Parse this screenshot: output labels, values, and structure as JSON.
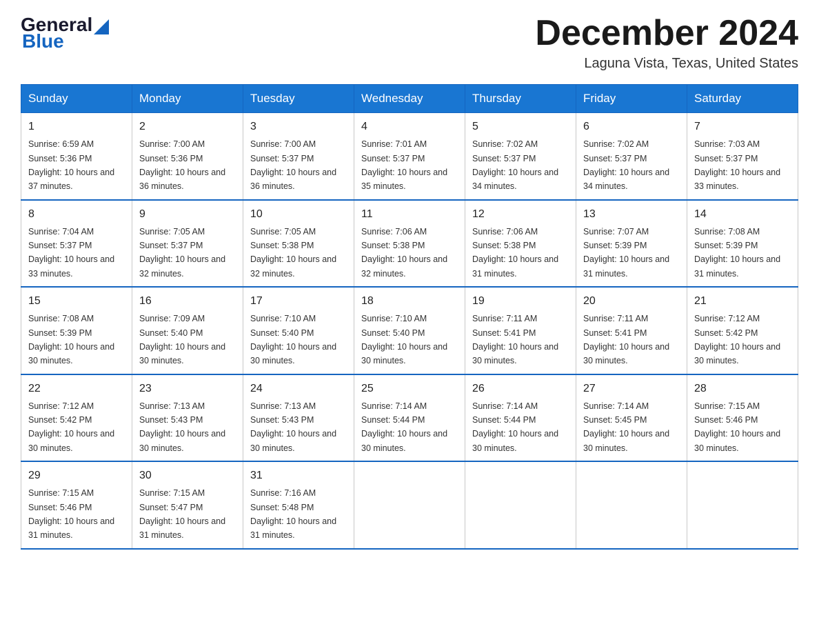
{
  "header": {
    "logo_general": "General",
    "logo_blue": "Blue",
    "month_title": "December 2024",
    "location": "Laguna Vista, Texas, United States"
  },
  "days_of_week": [
    "Sunday",
    "Monday",
    "Tuesday",
    "Wednesday",
    "Thursday",
    "Friday",
    "Saturday"
  ],
  "weeks": [
    [
      {
        "day": "1",
        "sunrise": "6:59 AM",
        "sunset": "5:36 PM",
        "daylight": "10 hours and 37 minutes."
      },
      {
        "day": "2",
        "sunrise": "7:00 AM",
        "sunset": "5:36 PM",
        "daylight": "10 hours and 36 minutes."
      },
      {
        "day": "3",
        "sunrise": "7:00 AM",
        "sunset": "5:37 PM",
        "daylight": "10 hours and 36 minutes."
      },
      {
        "day": "4",
        "sunrise": "7:01 AM",
        "sunset": "5:37 PM",
        "daylight": "10 hours and 35 minutes."
      },
      {
        "day": "5",
        "sunrise": "7:02 AM",
        "sunset": "5:37 PM",
        "daylight": "10 hours and 34 minutes."
      },
      {
        "day": "6",
        "sunrise": "7:02 AM",
        "sunset": "5:37 PM",
        "daylight": "10 hours and 34 minutes."
      },
      {
        "day": "7",
        "sunrise": "7:03 AM",
        "sunset": "5:37 PM",
        "daylight": "10 hours and 33 minutes."
      }
    ],
    [
      {
        "day": "8",
        "sunrise": "7:04 AM",
        "sunset": "5:37 PM",
        "daylight": "10 hours and 33 minutes."
      },
      {
        "day": "9",
        "sunrise": "7:05 AM",
        "sunset": "5:37 PM",
        "daylight": "10 hours and 32 minutes."
      },
      {
        "day": "10",
        "sunrise": "7:05 AM",
        "sunset": "5:38 PM",
        "daylight": "10 hours and 32 minutes."
      },
      {
        "day": "11",
        "sunrise": "7:06 AM",
        "sunset": "5:38 PM",
        "daylight": "10 hours and 32 minutes."
      },
      {
        "day": "12",
        "sunrise": "7:06 AM",
        "sunset": "5:38 PM",
        "daylight": "10 hours and 31 minutes."
      },
      {
        "day": "13",
        "sunrise": "7:07 AM",
        "sunset": "5:39 PM",
        "daylight": "10 hours and 31 minutes."
      },
      {
        "day": "14",
        "sunrise": "7:08 AM",
        "sunset": "5:39 PM",
        "daylight": "10 hours and 31 minutes."
      }
    ],
    [
      {
        "day": "15",
        "sunrise": "7:08 AM",
        "sunset": "5:39 PM",
        "daylight": "10 hours and 30 minutes."
      },
      {
        "day": "16",
        "sunrise": "7:09 AM",
        "sunset": "5:40 PM",
        "daylight": "10 hours and 30 minutes."
      },
      {
        "day": "17",
        "sunrise": "7:10 AM",
        "sunset": "5:40 PM",
        "daylight": "10 hours and 30 minutes."
      },
      {
        "day": "18",
        "sunrise": "7:10 AM",
        "sunset": "5:40 PM",
        "daylight": "10 hours and 30 minutes."
      },
      {
        "day": "19",
        "sunrise": "7:11 AM",
        "sunset": "5:41 PM",
        "daylight": "10 hours and 30 minutes."
      },
      {
        "day": "20",
        "sunrise": "7:11 AM",
        "sunset": "5:41 PM",
        "daylight": "10 hours and 30 minutes."
      },
      {
        "day": "21",
        "sunrise": "7:12 AM",
        "sunset": "5:42 PM",
        "daylight": "10 hours and 30 minutes."
      }
    ],
    [
      {
        "day": "22",
        "sunrise": "7:12 AM",
        "sunset": "5:42 PM",
        "daylight": "10 hours and 30 minutes."
      },
      {
        "day": "23",
        "sunrise": "7:13 AM",
        "sunset": "5:43 PM",
        "daylight": "10 hours and 30 minutes."
      },
      {
        "day": "24",
        "sunrise": "7:13 AM",
        "sunset": "5:43 PM",
        "daylight": "10 hours and 30 minutes."
      },
      {
        "day": "25",
        "sunrise": "7:14 AM",
        "sunset": "5:44 PM",
        "daylight": "10 hours and 30 minutes."
      },
      {
        "day": "26",
        "sunrise": "7:14 AM",
        "sunset": "5:44 PM",
        "daylight": "10 hours and 30 minutes."
      },
      {
        "day": "27",
        "sunrise": "7:14 AM",
        "sunset": "5:45 PM",
        "daylight": "10 hours and 30 minutes."
      },
      {
        "day": "28",
        "sunrise": "7:15 AM",
        "sunset": "5:46 PM",
        "daylight": "10 hours and 30 minutes."
      }
    ],
    [
      {
        "day": "29",
        "sunrise": "7:15 AM",
        "sunset": "5:46 PM",
        "daylight": "10 hours and 31 minutes."
      },
      {
        "day": "30",
        "sunrise": "7:15 AM",
        "sunset": "5:47 PM",
        "daylight": "10 hours and 31 minutes."
      },
      {
        "day": "31",
        "sunrise": "7:16 AM",
        "sunset": "5:48 PM",
        "daylight": "10 hours and 31 minutes."
      },
      null,
      null,
      null,
      null
    ]
  ]
}
